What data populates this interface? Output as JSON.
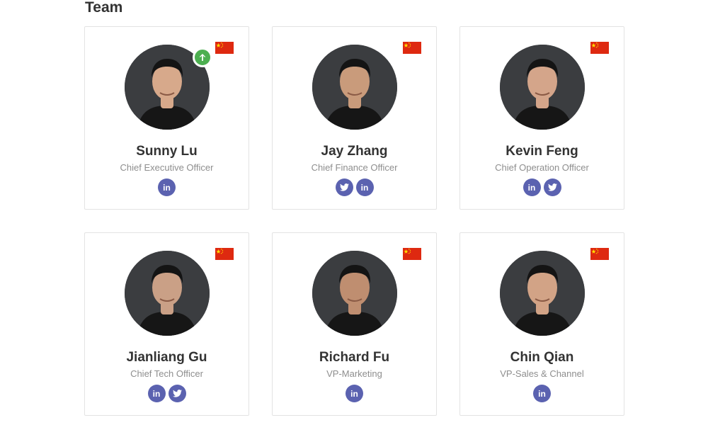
{
  "section": {
    "title": "Team"
  },
  "colors": {
    "social": "#5b62b0",
    "flag_red": "#de2910",
    "flag_yellow": "#ffde00",
    "badge_green": "#4caf50",
    "card_border": "#e3e3e3"
  },
  "members": [
    {
      "name": "Sunny Lu",
      "role": "Chief Executive Officer",
      "flag_icon": "china-flag-icon",
      "badge_icon": "arrow-up-icon",
      "socials": [
        {
          "icon": "linkedin-icon",
          "label": "in"
        }
      ]
    },
    {
      "name": "Jay Zhang",
      "role": "Chief Finance Officer",
      "flag_icon": "china-flag-icon",
      "socials": [
        {
          "icon": "twitter-icon"
        },
        {
          "icon": "linkedin-icon",
          "label": "in"
        }
      ]
    },
    {
      "name": "Kevin Feng",
      "role": "Chief Operation Officer",
      "flag_icon": "china-flag-icon",
      "socials": [
        {
          "icon": "linkedin-icon",
          "label": "in"
        },
        {
          "icon": "twitter-icon"
        }
      ]
    },
    {
      "name": "Jianliang Gu",
      "role": "Chief Tech Officer",
      "flag_icon": "china-flag-icon",
      "socials": [
        {
          "icon": "linkedin-icon",
          "label": "in"
        },
        {
          "icon": "twitter-icon"
        }
      ]
    },
    {
      "name": "Richard Fu",
      "role": "VP-Marketing",
      "flag_icon": "china-flag-icon",
      "socials": [
        {
          "icon": "linkedin-icon",
          "label": "in"
        }
      ]
    },
    {
      "name": "Chin Qian",
      "role": "VP-Sales & Channel",
      "flag_icon": "china-flag-icon",
      "socials": [
        {
          "icon": "linkedin-icon",
          "label": "in"
        }
      ]
    }
  ]
}
